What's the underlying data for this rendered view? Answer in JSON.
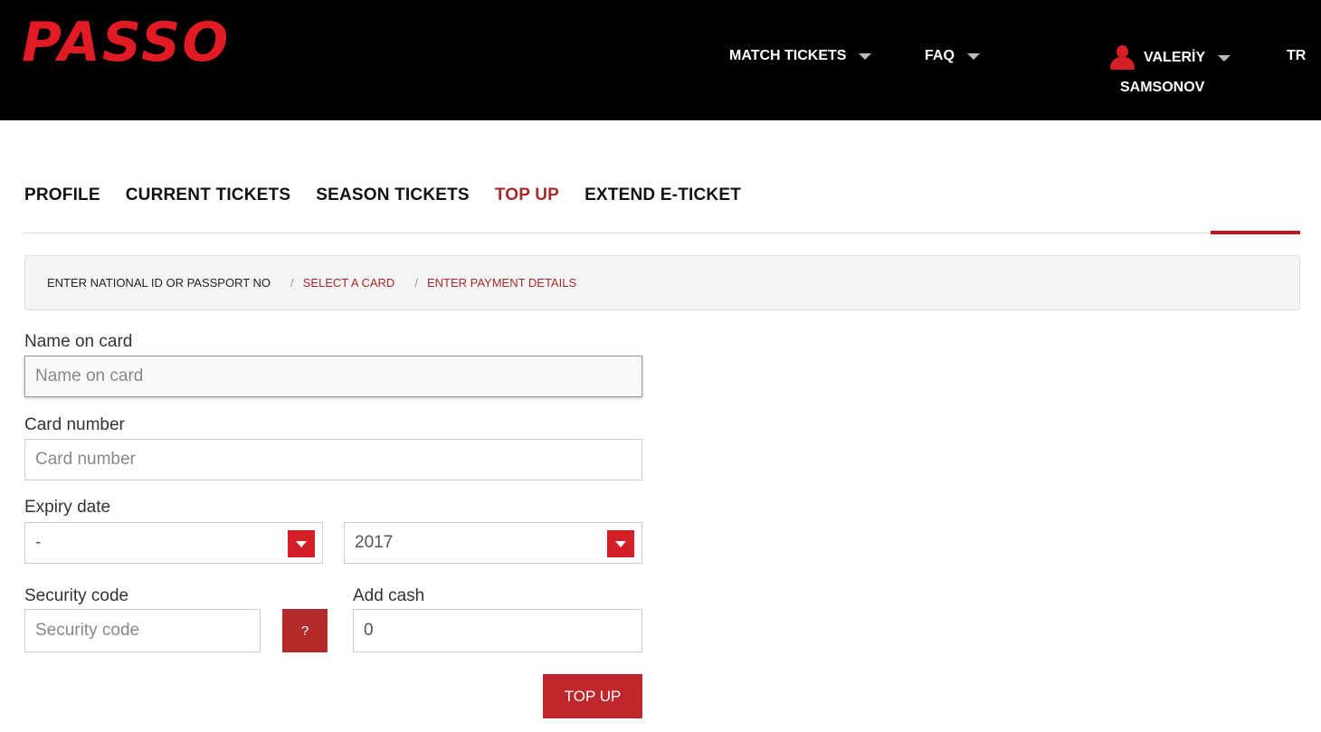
{
  "header": {
    "logo": "PASSO",
    "nav": {
      "match_tickets": "MATCH TICKETS",
      "faq": "FAQ",
      "user_first": "VALERİY",
      "user_last": "SAMSONOV",
      "language": "TR"
    }
  },
  "tabs": [
    {
      "label": "PROFILE"
    },
    {
      "label": "CURRENT TICKETS"
    },
    {
      "label": "SEASON TICKETS"
    },
    {
      "label": "TOP UP",
      "active": true
    },
    {
      "label": "EXTEND E-TICKET"
    }
  ],
  "breadcrumb": {
    "step1": "ENTER NATIONAL ID OR PASSPORT NO",
    "separator": "/",
    "step2": "SELECT A CARD",
    "step3": "ENTER PAYMENT DETAILS"
  },
  "form": {
    "name_label": "Name on card",
    "name_placeholder": "Name on card",
    "card_label": "Card number",
    "card_placeholder": "Card number",
    "expiry_label": "Expiry date",
    "expiry_month": "-",
    "expiry_year": "2017",
    "security_label": "Security code",
    "security_placeholder": "Security code",
    "help_label": "?",
    "cash_label": "Add cash",
    "cash_value": "0",
    "submit_label": "TOP UP"
  },
  "colors": {
    "brand_red": "#e01b24",
    "active_tab": "#a72a2a",
    "button_red": "#c0272d"
  }
}
